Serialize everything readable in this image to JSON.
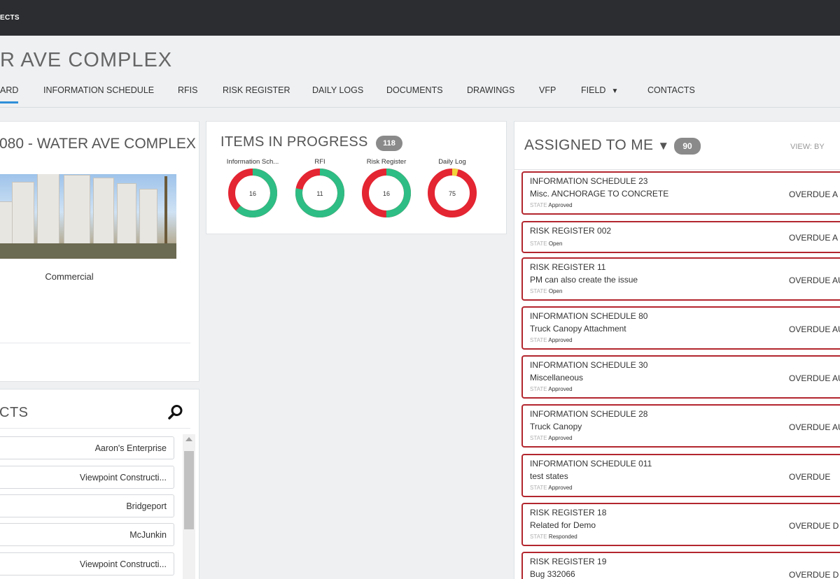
{
  "topbar": {
    "crumb": "ECTS"
  },
  "page_title": "R AVE COMPLEX",
  "tabs": [
    {
      "label": "ARD",
      "active": true
    },
    {
      "label": "INFORMATION SCHEDULE"
    },
    {
      "label": "RFIS"
    },
    {
      "label": "RISK REGISTER"
    },
    {
      "label": "DAILY LOGS"
    },
    {
      "label": "DOCUMENTS"
    },
    {
      "label": "DRAWINGS"
    },
    {
      "label": "VFP"
    },
    {
      "label": "FIELD",
      "caret": "▼"
    },
    {
      "label": "CONTACTS"
    }
  ],
  "project": {
    "title": "080 - WATER AVE COMPLEX",
    "category": "Commercial"
  },
  "contacts": {
    "title": "CTS",
    "items": [
      "Aaron's Enterprise",
      "Viewpoint Constructi...",
      "Bridgeport",
      "McJunkin",
      "Viewpoint Constructi..."
    ]
  },
  "items_in_progress": {
    "title": "ITEMS IN PROGRESS",
    "count": "118",
    "donuts": [
      {
        "label": "Information Sch...",
        "value": "16",
        "green_fraction": 0.62,
        "yellow_fraction": 0.0
      },
      {
        "label": "RFI",
        "value": "11",
        "green_fraction": 0.78,
        "yellow_fraction": 0.0
      },
      {
        "label": "Risk Register",
        "value": "16",
        "green_fraction": 0.5,
        "yellow_fraction": 0.0
      },
      {
        "label": "Daily Log",
        "value": "75",
        "green_fraction": 0.0,
        "yellow_fraction": 0.04
      }
    ]
  },
  "assigned": {
    "title": "ASSIGNED TO ME",
    "caret": "▼",
    "count": "90",
    "view_by": "VIEW: BY",
    "state_key": "STATE",
    "cards": [
      {
        "type": "INFORMATION SCHEDULE 23",
        "desc": "Misc. ANCHORAGE TO CONCRETE",
        "state": "Approved",
        "due": "OVERDUE A"
      },
      {
        "type": "RISK REGISTER 002",
        "desc": "",
        "state": "Open",
        "due": "OVERDUE A"
      },
      {
        "type": "RISK REGISTER 11",
        "desc": "PM can also create the issue",
        "state": "Open",
        "due": "OVERDUE AU"
      },
      {
        "type": "INFORMATION SCHEDULE 80",
        "desc": "Truck Canopy Attachment",
        "state": "Approved",
        "due": "OVERDUE AU"
      },
      {
        "type": "INFORMATION SCHEDULE 30",
        "desc": "Miscellaneous",
        "state": "Approved",
        "due": "OVERDUE AU"
      },
      {
        "type": "INFORMATION SCHEDULE 28",
        "desc": "Truck Canopy",
        "state": "Approved",
        "due": "OVERDUE AU"
      },
      {
        "type": "INFORMATION SCHEDULE 011",
        "desc": "test states",
        "state": "Approved",
        "due": "OVERDUE"
      },
      {
        "type": "RISK REGISTER 18",
        "desc": "Related for Demo",
        "state": "Responded",
        "due": "OVERDUE D"
      },
      {
        "type": "RISK REGISTER 19",
        "desc": "Bug 332066",
        "state": "",
        "due": "OVERDUE D"
      }
    ]
  },
  "colors": {
    "green": "#2ebd84",
    "red": "#e42532",
    "yellow": "#f2d43a",
    "accent": "#2f8fd8",
    "card_border": "#b3262e"
  }
}
